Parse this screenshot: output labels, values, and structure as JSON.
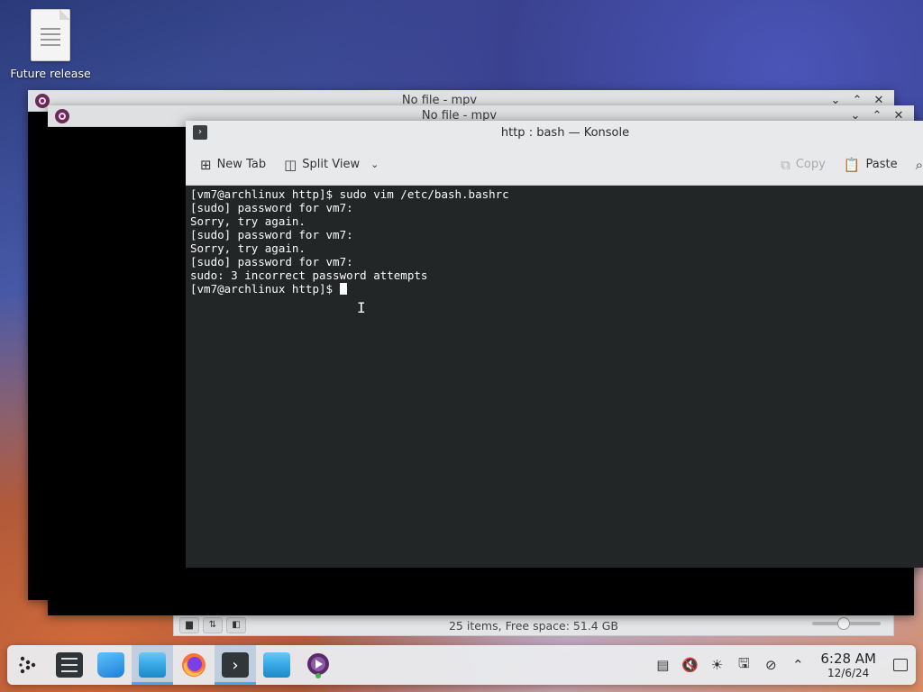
{
  "desktop": {
    "icon_label": "Future release"
  },
  "windows": {
    "mpv_back": {
      "title": "No file - mpv"
    },
    "mpv_front": {
      "title": "No file - mpv"
    },
    "file_manager": {
      "status": "25 items, Free space: 51.4 GB"
    }
  },
  "konsole": {
    "title": "http : bash — Konsole",
    "toolbar": {
      "new_tab": "New Tab",
      "split_view": "Split View",
      "copy": "Copy",
      "paste": "Paste"
    },
    "lines": [
      "[vm7@archlinux http]$ sudo vim /etc/bash.bashrc",
      "[sudo] password for vm7:",
      "Sorry, try again.",
      "[sudo] password for vm7:",
      "Sorry, try again.",
      "[sudo] password for vm7:",
      "sudo: 3 incorrect password attempts"
    ],
    "prompt": "[vm7@archlinux http]$ "
  },
  "taskbar": {
    "clock_time": "6:28 AM",
    "clock_date": "12/6/24"
  },
  "colors": {
    "accent": "#3daee9",
    "terminal_bg": "#232627",
    "terminal_fg": "#fcfcfc"
  }
}
